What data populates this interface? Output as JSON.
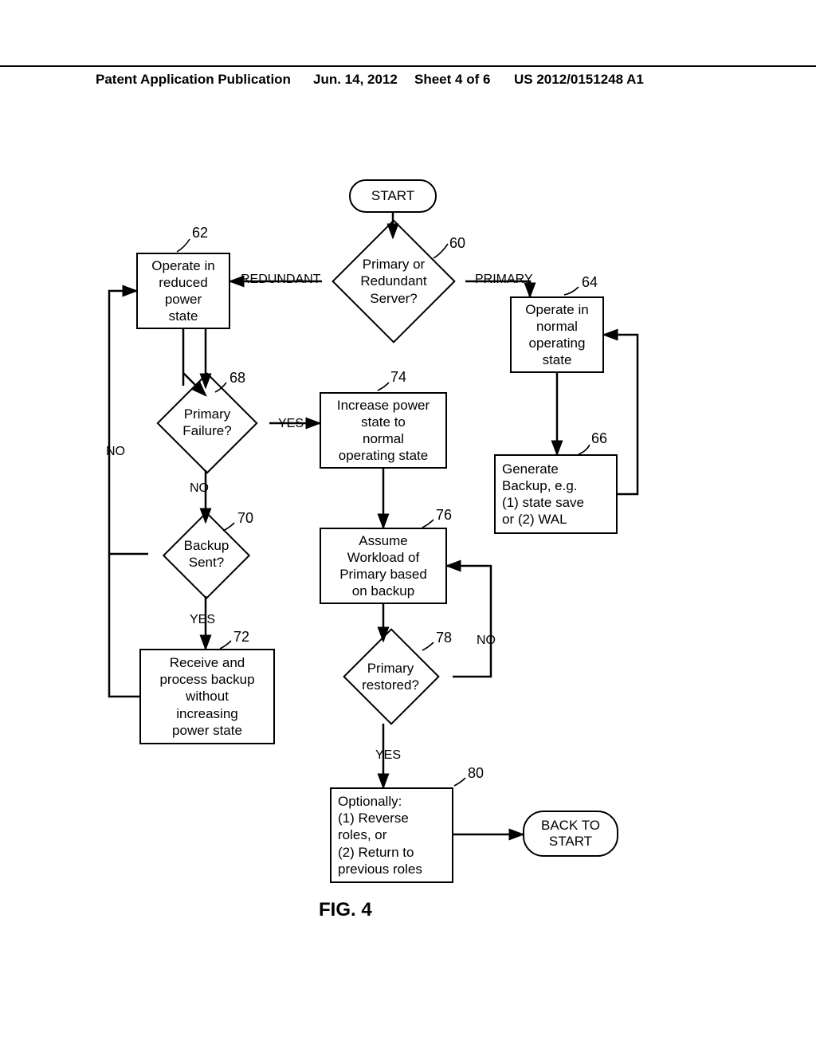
{
  "header": {
    "pubtype": "Patent Application Publication",
    "date": "Jun. 14, 2012",
    "sheet": "Sheet 4 of 6",
    "docnum": "US 2012/0151248 A1"
  },
  "fig_caption": "FIG.  4",
  "nodes": {
    "start": "START",
    "backstart": "BACK TO\nSTART",
    "d60": "Primary or\nRedundant\nServer?",
    "b62": "Operate in\nreduced\npower\nstate",
    "b64": "Operate in\nnormal\noperating\nstate",
    "b66": "Generate\nBackup, e.g.\n(1) state save\nor (2) WAL",
    "d68": "Primary\nFailure?",
    "d70": "Backup\nSent?",
    "b72": "Receive and\nprocess backup\nwithout\nincreasing\npower state",
    "b74": "Increase power\nstate to\nnormal\noperating state",
    "b76": "Assume\nWorkload of\nPrimary based\non backup",
    "d78": "Primary\nrestored?",
    "b80": "Optionally:\n(1)  Reverse\nroles, or\n(2)  Return to\nprevious roles"
  },
  "edges": {
    "redundant": "REDUNDANT",
    "primary": "PRIMARY",
    "yes": "YES",
    "no": "NO"
  },
  "refs": {
    "r60": "60",
    "r62": "62",
    "r64": "64",
    "r66": "66",
    "r68": "68",
    "r70": "70",
    "r72": "72",
    "r74": "74",
    "r76": "76",
    "r78": "78",
    "r80": "80"
  },
  "chart_data": {
    "type": "flowchart",
    "title": "FIG. 4",
    "nodes": [
      {
        "id": "start",
        "kind": "terminator",
        "text": "START"
      },
      {
        "id": "60",
        "kind": "decision",
        "text": "Primary or Redundant Server?"
      },
      {
        "id": "62",
        "kind": "process",
        "text": "Operate in reduced power state"
      },
      {
        "id": "64",
        "kind": "process",
        "text": "Operate in normal operating state"
      },
      {
        "id": "66",
        "kind": "process",
        "text": "Generate Backup, e.g. (1) state save or (2) WAL"
      },
      {
        "id": "68",
        "kind": "decision",
        "text": "Primary Failure?"
      },
      {
        "id": "70",
        "kind": "decision",
        "text": "Backup Sent?"
      },
      {
        "id": "72",
        "kind": "process",
        "text": "Receive and process backup without increasing power state"
      },
      {
        "id": "74",
        "kind": "process",
        "text": "Increase power state to normal operating state"
      },
      {
        "id": "76",
        "kind": "process",
        "text": "Assume Workload of Primary based on backup"
      },
      {
        "id": "78",
        "kind": "decision",
        "text": "Primary restored?"
      },
      {
        "id": "80",
        "kind": "process",
        "text": "Optionally: (1) Reverse roles, or (2) Return to previous roles"
      },
      {
        "id": "backstart",
        "kind": "terminator",
        "text": "BACK TO START"
      }
    ],
    "edges": [
      {
        "from": "start",
        "to": "60"
      },
      {
        "from": "60",
        "to": "62",
        "label": "REDUNDANT"
      },
      {
        "from": "60",
        "to": "64",
        "label": "PRIMARY"
      },
      {
        "from": "62",
        "to": "68"
      },
      {
        "from": "64",
        "to": "66"
      },
      {
        "from": "66",
        "to": "64"
      },
      {
        "from": "68",
        "to": "74",
        "label": "YES"
      },
      {
        "from": "68",
        "to": "70",
        "label": "NO"
      },
      {
        "from": "70",
        "to": "62",
        "label": "NO"
      },
      {
        "from": "70",
        "to": "72",
        "label": "YES"
      },
      {
        "from": "72",
        "to": "62"
      },
      {
        "from": "74",
        "to": "76"
      },
      {
        "from": "76",
        "to": "78"
      },
      {
        "from": "78",
        "to": "76",
        "label": "NO"
      },
      {
        "from": "78",
        "to": "80",
        "label": "YES"
      },
      {
        "from": "80",
        "to": "backstart"
      }
    ]
  }
}
